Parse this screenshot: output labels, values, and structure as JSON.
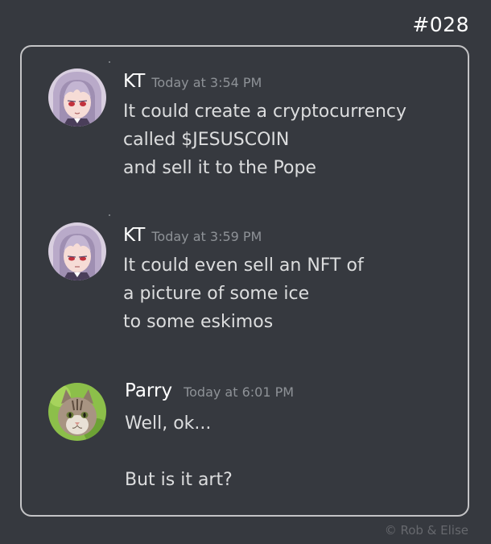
{
  "comic_number": "#028",
  "messages": [
    {
      "username": "KT",
      "timestamp": "Today at 3:54 PM",
      "avatar": "anime-girl-avatar",
      "lines": [
        "It could create a cryptocurrency",
        "called $JESUSCOIN",
        "and sell it to the Pope"
      ]
    },
    {
      "username": "KT",
      "timestamp": "Today at 3:59 PM",
      "avatar": "anime-girl-avatar",
      "lines": [
        "It could even sell an NFT of",
        "a picture of some ice",
        "to some eskimos"
      ]
    },
    {
      "username": "Parry",
      "timestamp": "Today at 6:01 PM",
      "avatar": "cat-avatar",
      "lines": [
        "Well, ok...",
        "",
        "But is it art?"
      ]
    }
  ],
  "copyright": "©  Rob & Elise",
  "colors": {
    "background": "#36393f",
    "username": "#ffffff",
    "timestamp": "#8e9297",
    "message_text": "#dcddde",
    "panel_border": "#c4c4c6"
  }
}
